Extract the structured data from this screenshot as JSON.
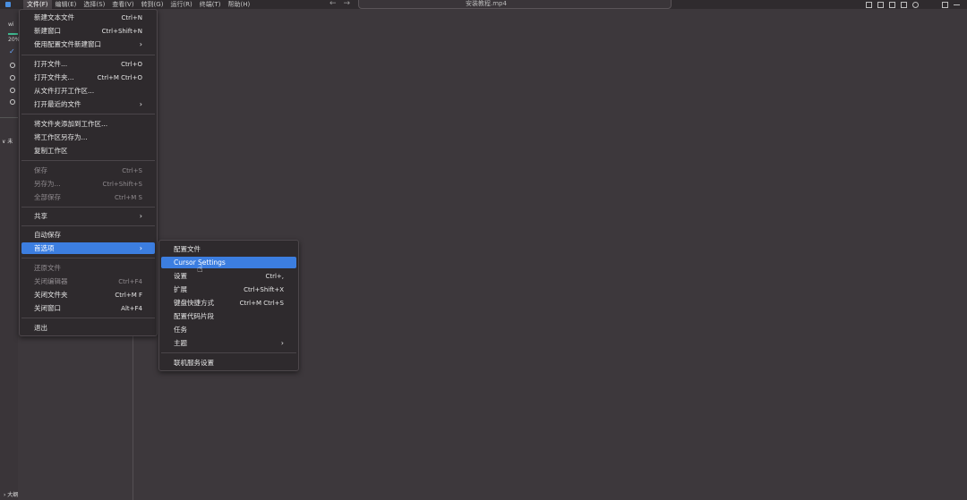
{
  "titlebar": {
    "menus": [
      "文件(F)",
      "编辑(E)",
      "选择(S)",
      "查看(V)",
      "转到(G)",
      "运行(R)",
      "终端(T)",
      "帮助(H)"
    ],
    "nav_back": "←",
    "nav_forward": "→",
    "overlay_title": "安装教程.mp4"
  },
  "sidebar": {
    "label_top": "wi",
    "label_percent": "20%",
    "section": "∨ 未",
    "outline": "› 大纲"
  },
  "file_menu": {
    "items": [
      {
        "label": "新建文本文件",
        "kb": "Ctrl+N"
      },
      {
        "label": "新建窗口",
        "kb": "Ctrl+Shift+N"
      },
      {
        "label": "使用配置文件新建窗口",
        "kb": "›"
      },
      {
        "label": "打开文件...",
        "kb": "Ctrl+O"
      },
      {
        "label": "打开文件夹...",
        "kb": "Ctrl+M Ctrl+O"
      },
      {
        "label": "从文件打开工作区...",
        "kb": ""
      },
      {
        "label": "打开最近的文件",
        "kb": "›"
      },
      {
        "label": "将文件夹添加到工作区...",
        "kb": ""
      },
      {
        "label": "将工作区另存为...",
        "kb": ""
      },
      {
        "label": "复制工作区",
        "kb": ""
      },
      {
        "label": "保存",
        "kb": "Ctrl+S"
      },
      {
        "label": "另存为...",
        "kb": "Ctrl+Shift+S"
      },
      {
        "label": "全部保存",
        "kb": "Ctrl+M S"
      },
      {
        "label": "共享",
        "kb": "›"
      },
      {
        "label": "自动保存",
        "kb": ""
      },
      {
        "label": "首选项",
        "kb": "›"
      },
      {
        "label": "还原文件",
        "kb": ""
      },
      {
        "label": "关闭编辑器",
        "kb": "Ctrl+F4"
      },
      {
        "label": "关闭文件夹",
        "kb": "Ctrl+M F"
      },
      {
        "label": "关闭窗口",
        "kb": "Alt+F4"
      },
      {
        "label": "退出",
        "kb": ""
      }
    ]
  },
  "prefs_menu": {
    "items": [
      {
        "label": "配置文件",
        "kb": ""
      },
      {
        "label": "Cursor Settings",
        "kb": ""
      },
      {
        "label": "设置",
        "kb": "Ctrl+,"
      },
      {
        "label": "扩展",
        "kb": "Ctrl+Shift+X"
      },
      {
        "label": "键盘快捷方式",
        "kb": "Ctrl+M Ctrl+S"
      },
      {
        "label": "配置代码片段",
        "kb": ""
      },
      {
        "label": "任务",
        "kb": ""
      },
      {
        "label": "主题",
        "kb": "›"
      },
      {
        "label": "联机服务设置",
        "kb": ""
      }
    ]
  },
  "colors": {
    "background": "#3d383c",
    "menu_bg": "#2e2a2d",
    "highlight": "#3c7ee0",
    "progress_accent": "#3fb58e"
  }
}
